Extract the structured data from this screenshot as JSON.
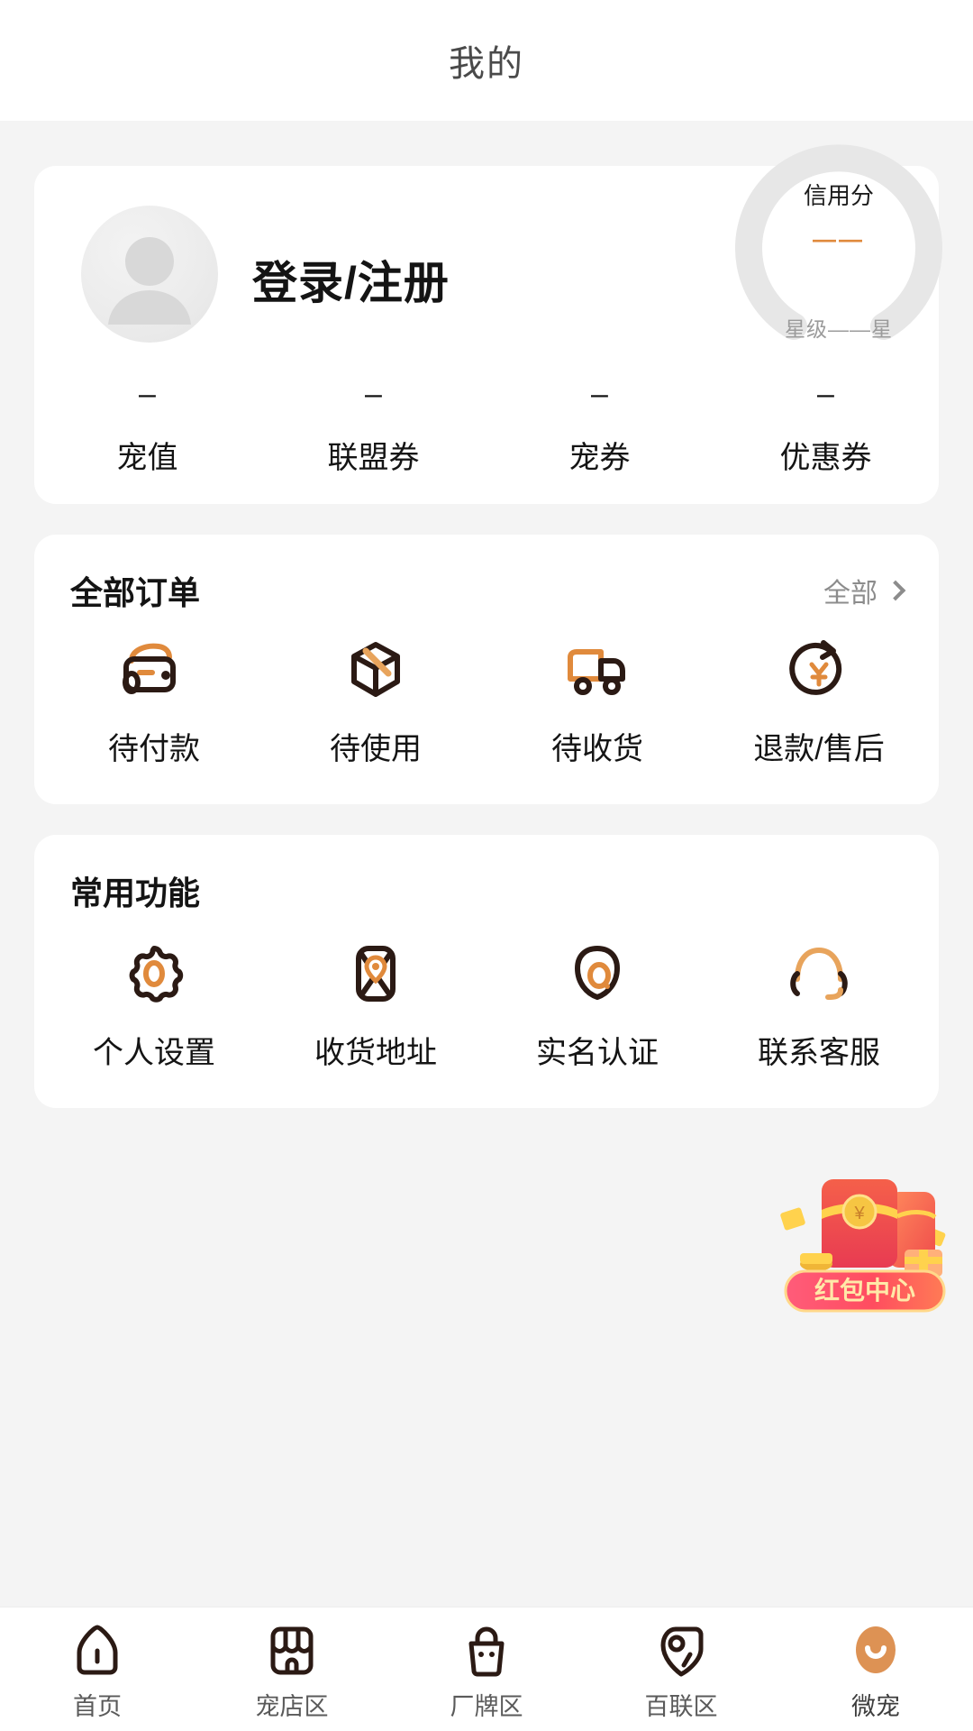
{
  "header": {
    "title": "我的"
  },
  "theme": {
    "accent": "#e08a3c",
    "dark": "#2b1a14",
    "bg": "#f4f4f4",
    "card": "#ffffff",
    "text": "#141414",
    "muted": "#8c8c8c"
  },
  "profile": {
    "login_label": "登录/注册",
    "avatar_icon": "default-user-avatar-icon",
    "credit": {
      "label": "信用分",
      "value": "——",
      "star_text": "星级——星"
    },
    "stats": [
      {
        "value": "–",
        "label": "宠值",
        "icon": "pet-value-icon"
      },
      {
        "value": "–",
        "label": "联盟券",
        "icon": "alliance-coupon-icon"
      },
      {
        "value": "–",
        "label": "宠券",
        "icon": "pet-coupon-icon"
      },
      {
        "value": "–",
        "label": "优惠券",
        "icon": "discount-coupon-icon"
      }
    ]
  },
  "orders": {
    "title": "全部订单",
    "more_label": "全部",
    "items": [
      {
        "label": "待付款",
        "icon": "wallet-icon"
      },
      {
        "label": "待使用",
        "icon": "package-box-icon"
      },
      {
        "label": "待收货",
        "icon": "delivery-truck-icon"
      },
      {
        "label": "退款/售后",
        "icon": "refund-yuan-icon"
      }
    ]
  },
  "functions": {
    "title": "常用功能",
    "items": [
      {
        "label": "个人设置",
        "icon": "gear-icon"
      },
      {
        "label": "收货地址",
        "icon": "address-location-icon"
      },
      {
        "label": "实名认证",
        "icon": "id-verify-icon"
      },
      {
        "label": "联系客服",
        "icon": "headset-icon"
      }
    ]
  },
  "floating": {
    "redpacket_label": "红包中心",
    "icon": "red-packet-icon"
  },
  "tabbar": {
    "items": [
      {
        "label": "首页",
        "icon": "home-icon",
        "active": false
      },
      {
        "label": "宠店区",
        "icon": "shop-icon",
        "active": false
      },
      {
        "label": "厂牌区",
        "icon": "brand-bag-icon",
        "active": false
      },
      {
        "label": "百联区",
        "icon": "tag-icon",
        "active": false
      },
      {
        "label": "微宠",
        "icon": "profile-smile-icon",
        "active": true
      }
    ]
  }
}
